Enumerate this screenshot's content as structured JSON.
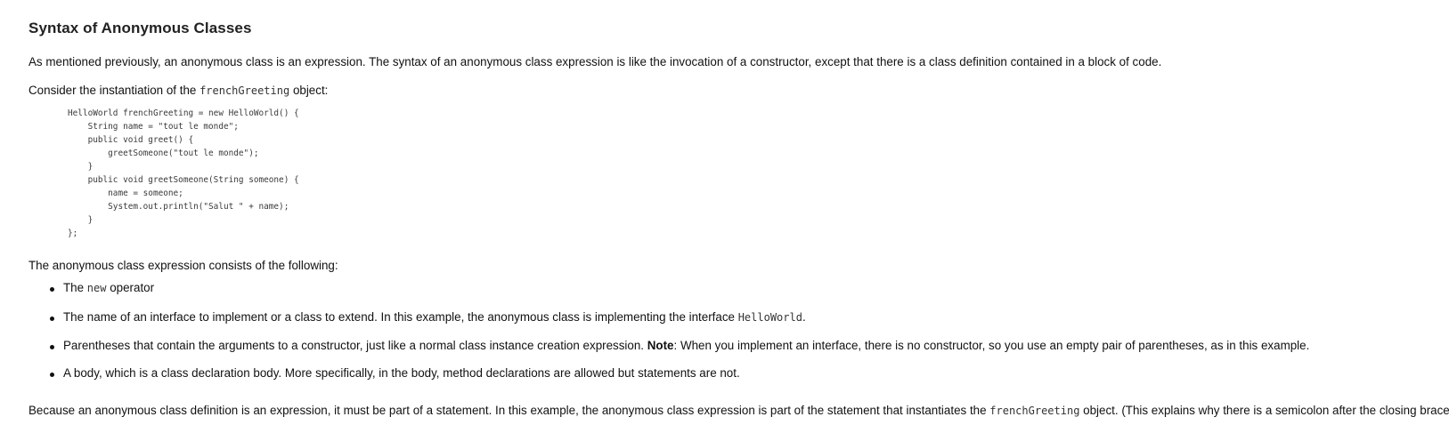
{
  "heading": "Syntax of Anonymous Classes",
  "intro": "As mentioned previously, an anonymous class is an expression. The syntax of an anonymous class expression is like the invocation of a constructor, except that there is a class definition contained in a block of code.",
  "consider": {
    "before": "Consider the instantiation of the ",
    "code": "frenchGreeting",
    "after": " object:"
  },
  "code_block": "HelloWorld frenchGreeting = new HelloWorld() {\n    String name = \"tout le monde\";\n    public void greet() {\n        greetSomeone(\"tout le monde\");\n    }\n    public void greetSomeone(String someone) {\n        name = someone;\n        System.out.println(\"Salut \" + name);\n    }\n};",
  "consists": "The anonymous class expression consists of the following:",
  "bullets": {
    "b1": {
      "before": "The ",
      "code": "new",
      "after": " operator"
    },
    "b2": {
      "before": "The name of an interface to implement or a class to extend. In this example, the anonymous class is implementing the interface ",
      "code": "HelloWorld",
      "after": "."
    },
    "b3": {
      "before": "Parentheses that contain the arguments to a constructor, just like a normal class instance creation expression. ",
      "note_label": "Note",
      "after": ": When you implement an interface, there is no constructor, so you use an empty pair of parentheses, as in this example."
    },
    "b4": {
      "text": "A body, which is a class declaration body. More specifically, in the body, method declarations are allowed but statements are not."
    }
  },
  "closing": {
    "before": "Because an anonymous class definition is an expression, it must be part of a statement. In this example, the anonymous class expression is part of the statement that instantiates the ",
    "code": "frenchGreeting",
    "after": " object. (This explains why there is a semicolon after the closing brace.)"
  }
}
